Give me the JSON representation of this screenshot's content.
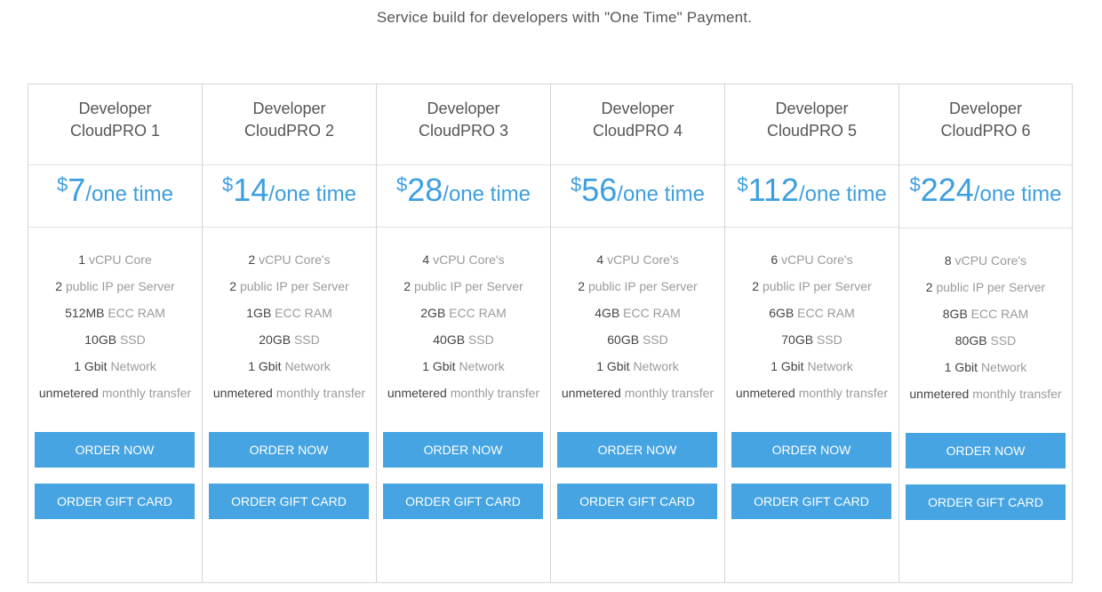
{
  "tagline": "Service build for developers with \"One Time\" Payment.",
  "accent_color": "#45a4e1",
  "plans": [
    {
      "name_line1": "Developer",
      "name_line2": "CloudPRO 1",
      "currency": "$",
      "amount": "7",
      "period": "/one time",
      "features": [
        {
          "value": "1",
          "unit": "vCPU Core"
        },
        {
          "value": "2",
          "unit": "public IP per Server"
        },
        {
          "value": "512MB",
          "unit": "ECC RAM"
        },
        {
          "value": "10GB",
          "unit": "SSD"
        },
        {
          "value": "1 Gbit",
          "unit": "Network"
        },
        {
          "value": "unmetered",
          "unit": "monthly transfer"
        }
      ],
      "order_label": "ORDER NOW",
      "gift_label": "ORDER GIFT CARD"
    },
    {
      "name_line1": "Developer",
      "name_line2": "CloudPRO 2",
      "currency": "$",
      "amount": "14",
      "period": "/one time",
      "features": [
        {
          "value": "2",
          "unit": "vCPU Core's"
        },
        {
          "value": "2",
          "unit": "public IP per Server"
        },
        {
          "value": "1GB",
          "unit": "ECC RAM"
        },
        {
          "value": "20GB",
          "unit": "SSD"
        },
        {
          "value": "1 Gbit",
          "unit": "Network"
        },
        {
          "value": "unmetered",
          "unit": "monthly transfer"
        }
      ],
      "order_label": "ORDER NOW",
      "gift_label": "ORDER GIFT CARD"
    },
    {
      "name_line1": "Developer",
      "name_line2": "CloudPRO 3",
      "currency": "$",
      "amount": "28",
      "period": "/one time",
      "features": [
        {
          "value": "4",
          "unit": "vCPU Core's"
        },
        {
          "value": "2",
          "unit": "public IP per Server"
        },
        {
          "value": "2GB",
          "unit": "ECC RAM"
        },
        {
          "value": "40GB",
          "unit": "SSD"
        },
        {
          "value": "1 Gbit",
          "unit": "Network"
        },
        {
          "value": "unmetered",
          "unit": "monthly transfer"
        }
      ],
      "order_label": "ORDER NOW",
      "gift_label": "ORDER GIFT CARD"
    },
    {
      "name_line1": "Developer",
      "name_line2": "CloudPRO 4",
      "currency": "$",
      "amount": "56",
      "period": "/one time",
      "features": [
        {
          "value": "4",
          "unit": "vCPU Core's"
        },
        {
          "value": "2",
          "unit": "public IP per Server"
        },
        {
          "value": "4GB",
          "unit": "ECC RAM"
        },
        {
          "value": "60GB",
          "unit": "SSD"
        },
        {
          "value": "1 Gbit",
          "unit": "Network"
        },
        {
          "value": "unmetered",
          "unit": "monthly transfer"
        }
      ],
      "order_label": "ORDER NOW",
      "gift_label": "ORDER GIFT CARD"
    },
    {
      "name_line1": "Developer",
      "name_line2": "CloudPRO 5",
      "currency": "$",
      "amount": "112",
      "period": "/one time",
      "features": [
        {
          "value": "6",
          "unit": "vCPU Core's"
        },
        {
          "value": "2",
          "unit": "public IP per Server"
        },
        {
          "value": "6GB",
          "unit": "ECC RAM"
        },
        {
          "value": "70GB",
          "unit": "SSD"
        },
        {
          "value": "1 Gbit",
          "unit": "Network"
        },
        {
          "value": "unmetered",
          "unit": "monthly transfer"
        }
      ],
      "order_label": "ORDER NOW",
      "gift_label": "ORDER GIFT CARD"
    },
    {
      "name_line1": "Developer",
      "name_line2": "CloudPRO 6",
      "currency": "$",
      "amount": "224",
      "period": "/one time",
      "features": [
        {
          "value": "8",
          "unit": "vCPU Core's"
        },
        {
          "value": "2",
          "unit": "public IP per Server"
        },
        {
          "value": "8GB",
          "unit": "ECC RAM"
        },
        {
          "value": "80GB",
          "unit": "SSD"
        },
        {
          "value": "1 Gbit",
          "unit": "Network"
        },
        {
          "value": "unmetered",
          "unit": "monthly transfer"
        }
      ],
      "order_label": "ORDER NOW",
      "gift_label": "ORDER GIFT CARD"
    }
  ]
}
